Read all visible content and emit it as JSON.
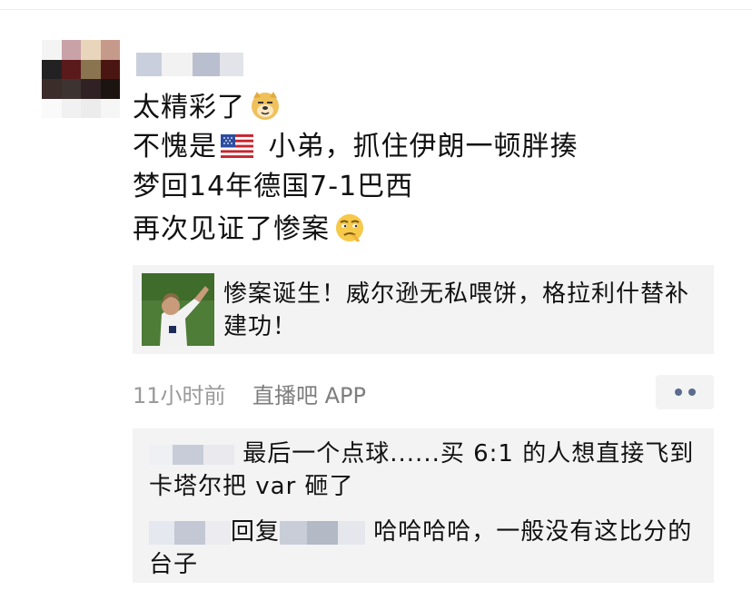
{
  "post": {
    "line1": "太精彩了",
    "line1_emoji": "doge-face-icon",
    "line2_a": "不愧是",
    "line2_flag": "us-flag-icon",
    "line2_b": " 小弟，抓住伊朗一顿胖揍",
    "line3": "梦回14年德国7-1巴西",
    "line4": "再次见证了惨案",
    "line4_emoji": "smirk-face-icon"
  },
  "link_card": {
    "title": "惨案诞生！威尔逊无私喂饼，格拉利什替补建功！"
  },
  "meta": {
    "time": "11小时前",
    "source": "直播吧 APP"
  },
  "comments": [
    {
      "text": "最后一个点球......买 6:1 的人想直接飞到卡塔尔把 var 砸了"
    },
    {
      "reply_word": "回复",
      "text": "哈哈哈哈，一般没有这比分的台子"
    }
  ],
  "colors": {
    "meta_gray": "#9a9a9a",
    "panel_bg": "#f3f3f3",
    "more_dots": "#5a6d8f"
  }
}
